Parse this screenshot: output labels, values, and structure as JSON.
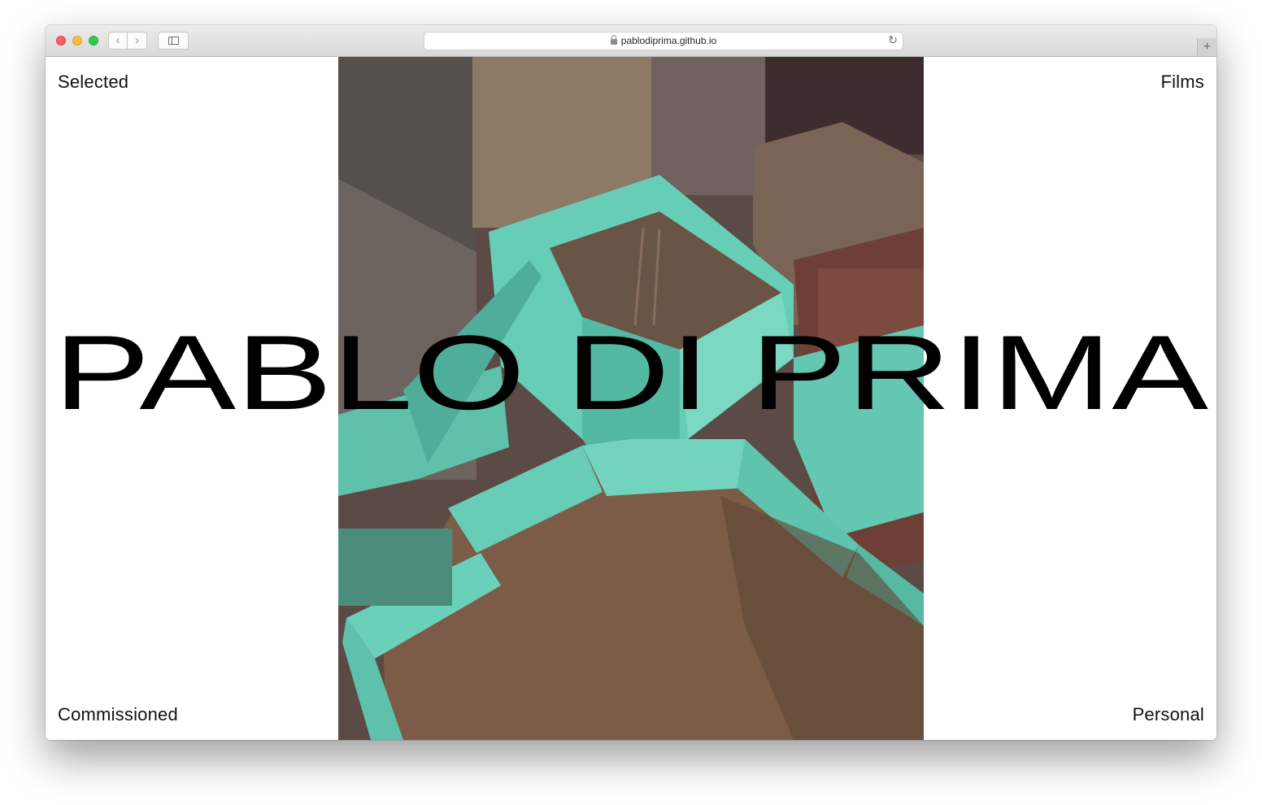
{
  "browser": {
    "url": "pablodiprima.github.io",
    "back_glyph": "‹",
    "forward_glyph": "›",
    "reload_glyph": "↻",
    "newtab_glyph": "+",
    "icons": [
      "back-chevron-icon",
      "forward-chevron-icon",
      "sidebar-icon",
      "lock-icon",
      "reload-icon",
      "plus-icon"
    ]
  },
  "nav": {
    "top_left": "Selected",
    "top_right": "Films",
    "bottom_left": "Commissioned",
    "bottom_right": "Personal"
  },
  "hero": {
    "title": "PABLO DI PRIMA"
  },
  "colors": {
    "text": "#111111",
    "turquoise_wall": "#6fd3bd",
    "rooftop_floor": "#7a5a45"
  }
}
